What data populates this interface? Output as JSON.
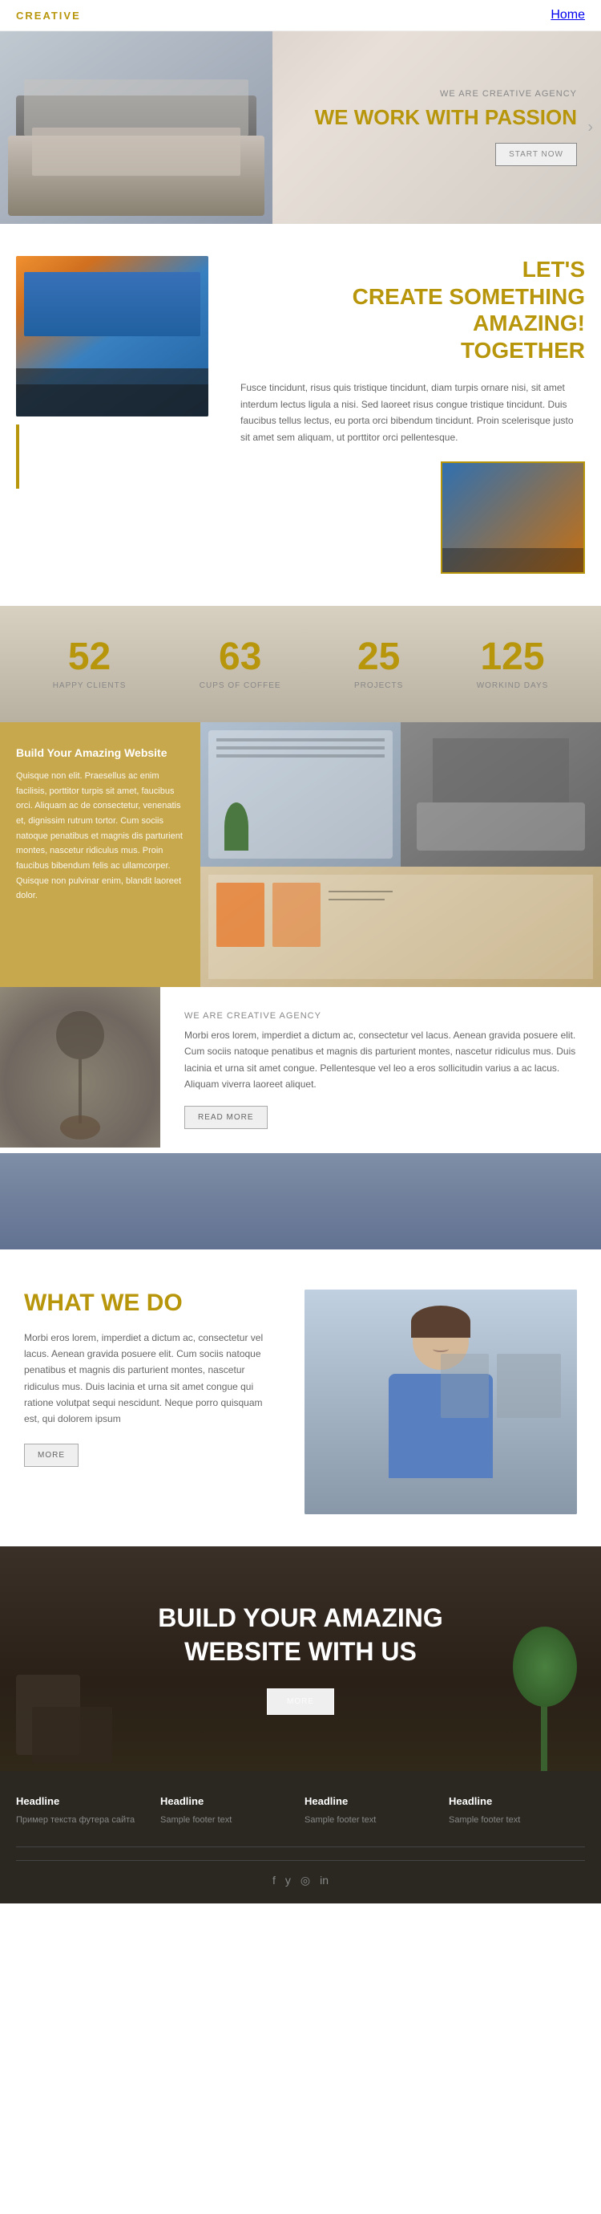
{
  "header": {
    "logo": "CREATIVE",
    "nav": {
      "home": "Home"
    }
  },
  "hero": {
    "subtitle": "WE ARE CREATIVE AGENCY",
    "title": "WE WORK WITH PASSION",
    "cta": "START NOW",
    "arrow": "›"
  },
  "create": {
    "title_line1": "LET'S",
    "title_line2": "CREATE SOMETHING",
    "title_line3": "AMAZING!",
    "title_line4": "TOGETHER",
    "body": "Fusce tincidunt, risus quis tristique tincidunt, diam turpis ornare nisi, sit amet interdum lectus ligula a nisi. Sed laoreet risus congue tristique tincidunt. Duis faucibus tellus lectus, eu porta orci bibendum tincidunt. Proin scelerisque justo sit amet sem aliquam, ut porttitor orci pellentesque."
  },
  "stats": [
    {
      "number": "52",
      "label": "HAPPY CLIENTS"
    },
    {
      "number": "63",
      "label": "CUPS OF COFFEE"
    },
    {
      "number": "25",
      "label": "PROJECTS"
    },
    {
      "number": "125",
      "label": "WORKIND DAYS"
    }
  ],
  "build_website": {
    "title": "Build Your Amazing Website",
    "body": "Quisque non elit. Praesellus ac enim facilisis, porttitor turpis sit amet, faucibus orci. Aliquam ac de consectetur, venenatis et, dignissim rutrum tortor. Cum sociis natoque penatibus et magnis dis parturient montes, nascetur ridiculus mus. Proin faucibus bibendum felis ac ullamcorper. Quisque non pulvinar enim, blandit laoreet dolor."
  },
  "agency": {
    "subtitle": "WE ARE CREATIVE AGENCY",
    "body": "Morbi eros lorem, imperdiet a dictum ac, consectetur vel lacus. Aenean gravida posuere elit. Cum sociis natoque penatibus et magnis dis parturient montes, nascetur ridiculus mus. Duis lacinia et urna sit amet congue. Pellentesque vel leo a eros sollicitudin varius a ac lacus. Aliquam viverra laoreet aliquet.",
    "read_more": "READ MORE"
  },
  "whatwedo": {
    "title": "WHAT WE DO",
    "body": "Morbi eros lorem, imperdiet a dictum ac, consectetur vel lacus. Aenean gravida posuere elit. Cum sociis natoque penatibus et magnis dis parturient montes, nascetur ridiculus mus. Duis lacinia et urna sit amet congue qui ratione volutpat sequi nescidunt. Neque porro quisquam est, qui dolorem ipsum",
    "more": "MORE"
  },
  "build_dark": {
    "title_line1": "BUILD YOUR AMAZING",
    "title_line2": "WEBSITE WITH US",
    "more": "MORE"
  },
  "footer": {
    "columns": [
      {
        "title": "Headline",
        "text": "Пример текста футера сайта"
      },
      {
        "title": "Headline",
        "text": "Sample footer text"
      },
      {
        "title": "Headline",
        "text": "Sample footer text"
      },
      {
        "title": "Headline",
        "text": "Sample footer text"
      }
    ],
    "social": [
      "f",
      "y",
      "◎",
      "in"
    ]
  }
}
